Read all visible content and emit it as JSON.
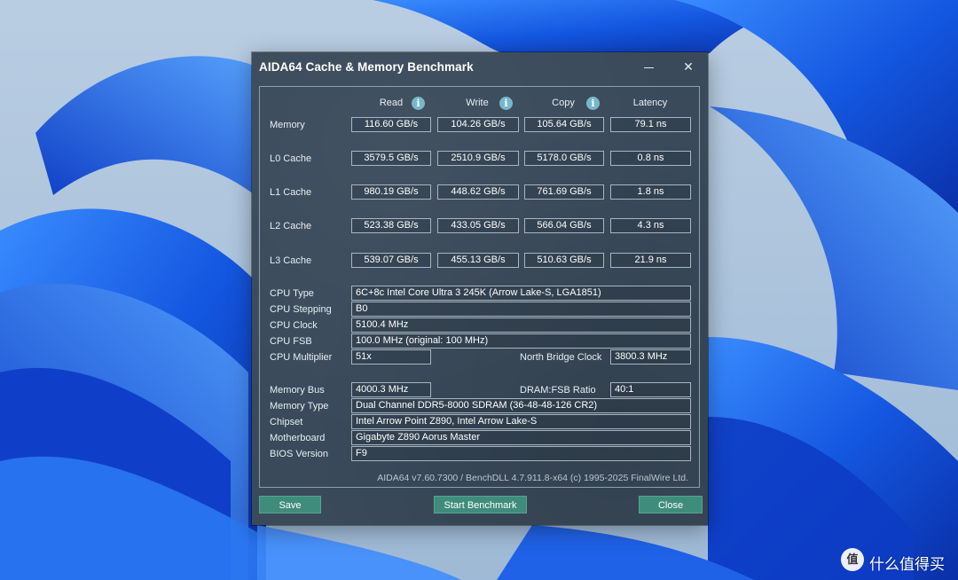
{
  "window": {
    "title": "AIDA64 Cache & Memory Benchmark",
    "minimize_glyph": "",
    "close_glyph": "✕"
  },
  "columns": {
    "read": "Read",
    "write": "Write",
    "copy": "Copy",
    "latency": "Latency",
    "info_glyph": "i"
  },
  "rows": [
    {
      "label": "Memory",
      "read": "116.60 GB/s",
      "write": "104.26 GB/s",
      "copy": "105.64 GB/s",
      "latency": "79.1 ns"
    },
    {
      "label": "L0 Cache",
      "read": "3579.5 GB/s",
      "write": "2510.9 GB/s",
      "copy": "5178.0 GB/s",
      "latency": "0.8 ns"
    },
    {
      "label": "L1 Cache",
      "read": "980.19 GB/s",
      "write": "448.62 GB/s",
      "copy": "761.69 GB/s",
      "latency": "1.8 ns"
    },
    {
      "label": "L2 Cache",
      "read": "523.38 GB/s",
      "write": "433.05 GB/s",
      "copy": "566.04 GB/s",
      "latency": "4.3 ns"
    },
    {
      "label": "L3 Cache",
      "read": "539.07 GB/s",
      "write": "455.13 GB/s",
      "copy": "510.63 GB/s",
      "latency": "21.9 ns"
    }
  ],
  "cpu": {
    "type_label": "CPU Type",
    "type_value": "6C+8c Intel Core Ultra 3 245K  (Arrow Lake-S, LGA1851)",
    "stepping_label": "CPU Stepping",
    "stepping_value": "B0",
    "clock_label": "CPU Clock",
    "clock_value": "5100.4 MHz",
    "fsb_label": "CPU FSB",
    "fsb_value": "100.0 MHz  (original: 100 MHz)",
    "multiplier_label": "CPU Multiplier",
    "multiplier_value": "51x",
    "nb_clock_label": "North Bridge Clock",
    "nb_clock_value": "3800.3 MHz"
  },
  "memory": {
    "bus_label": "Memory Bus",
    "bus_value": "4000.3 MHz",
    "ratio_label": "DRAM:FSB Ratio",
    "ratio_value": "40:1",
    "type_label": "Memory Type",
    "type_value": "Dual Channel DDR5-8000 SDRAM  (36-48-48-126 CR2)",
    "chipset_label": "Chipset",
    "chipset_value": "Intel Arrow Point Z890, Intel Arrow Lake-S",
    "motherboard_label": "Motherboard",
    "motherboard_value": "Gigabyte Z890 Aorus Master",
    "bios_label": "BIOS Version",
    "bios_value": "F9"
  },
  "footer": "AIDA64 v7.60.7300 / BenchDLL 4.7.911.8-x64  (c) 1995-2025 FinalWire Ltd.",
  "buttons": {
    "save": "Save",
    "start": "Start Benchmark",
    "close": "Close"
  },
  "watermark": {
    "logo": "值",
    "text": "什么值得买"
  },
  "colors": {
    "window_bg": "#3a4a5a",
    "button_bg": "#3f8c7c",
    "info_icon": "#77b7c9",
    "wallpaper_blue": "#1f5fe0"
  }
}
